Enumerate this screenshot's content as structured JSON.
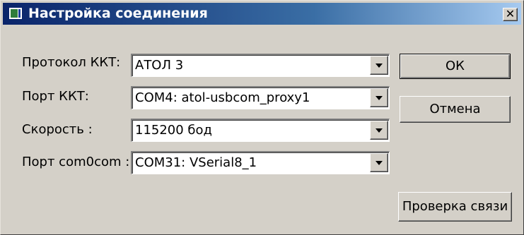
{
  "window": {
    "title": "Настройка соединения",
    "close_glyph": "✕"
  },
  "fields": [
    {
      "label": "Протокол ККТ:",
      "value": "АТОЛ 3"
    },
    {
      "label": "Порт ККТ:",
      "value": "COM4: atol-usbcom_proxy1"
    },
    {
      "label": "Скорость :",
      "value": "115200 бод"
    },
    {
      "label": "Порт com0com :",
      "value": "COM31: VSerial8_1"
    }
  ],
  "buttons": {
    "ok": "ОК",
    "cancel": "Отмена",
    "test": "Проверка связи"
  },
  "icons": {
    "app": "app-window-icon",
    "close": "close-icon",
    "dropdown": "chevron-down-icon"
  },
  "colors": {
    "title_gradient_start": "#0a246a",
    "title_gradient_end": "#a6caf0",
    "face": "#d4d0c8"
  }
}
